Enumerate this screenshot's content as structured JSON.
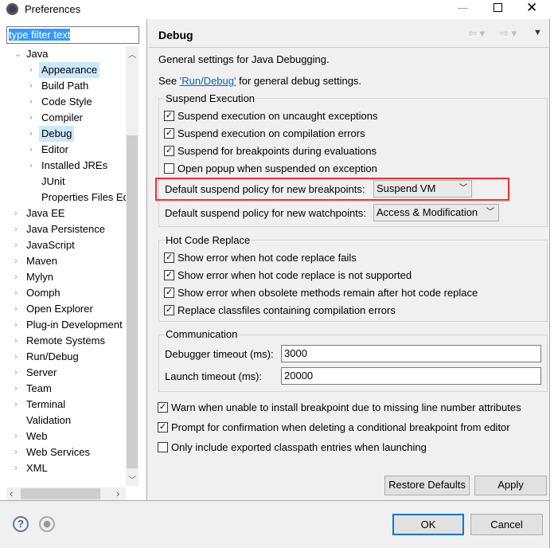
{
  "window": {
    "title": "Preferences"
  },
  "filter": {
    "placeholder": "type filter text"
  },
  "tree": [
    {
      "label": "Java",
      "level": 0,
      "expanded": true
    },
    {
      "label": "Appearance",
      "level": 1
    },
    {
      "label": "Build Path",
      "level": 1
    },
    {
      "label": "Code Style",
      "level": 1
    },
    {
      "label": "Compiler",
      "level": 1
    },
    {
      "label": "Debug",
      "level": 1,
      "selected": true
    },
    {
      "label": "Editor",
      "level": 1
    },
    {
      "label": "Installed JREs",
      "level": 1
    },
    {
      "label": "JUnit",
      "level": 1,
      "leaf": true
    },
    {
      "label": "Properties Files Ed",
      "level": 1,
      "leaf": true
    },
    {
      "label": "Java EE",
      "level": 0
    },
    {
      "label": "Java Persistence",
      "level": 0
    },
    {
      "label": "JavaScript",
      "level": 0
    },
    {
      "label": "Maven",
      "level": 0
    },
    {
      "label": "Mylyn",
      "level": 0
    },
    {
      "label": "Oomph",
      "level": 0
    },
    {
      "label": "Open Explorer",
      "level": 0
    },
    {
      "label": "Plug-in Development",
      "level": 0
    },
    {
      "label": "Remote Systems",
      "level": 0
    },
    {
      "label": "Run/Debug",
      "level": 0
    },
    {
      "label": "Server",
      "level": 0
    },
    {
      "label": "Team",
      "level": 0
    },
    {
      "label": "Terminal",
      "level": 0
    },
    {
      "label": "Validation",
      "level": 0,
      "leaf": true
    },
    {
      "label": "Web",
      "level": 0
    },
    {
      "label": "Web Services",
      "level": 0
    },
    {
      "label": "XML",
      "level": 0
    }
  ],
  "page": {
    "title": "Debug",
    "desc": "General settings for Java Debugging.",
    "see_pre": "See ",
    "see_link": "'Run/Debug'",
    "see_post": " for general debug settings.",
    "suspend": {
      "title": "Suspend Execution",
      "items": [
        {
          "label": "Suspend execution on uncaught exceptions",
          "checked": true
        },
        {
          "label": "Suspend execution on compilation errors",
          "checked": true
        },
        {
          "label": "Suspend for breakpoints during evaluations",
          "checked": true
        },
        {
          "label": "Open popup when suspended on exception",
          "checked": false
        }
      ],
      "bp_policy_label": "Default suspend policy for new breakpoints:",
      "bp_policy_value": "Suspend VM",
      "wp_policy_label": "Default suspend policy for new watchpoints:",
      "wp_policy_value": "Access & Modification"
    },
    "hcr": {
      "title": "Hot Code Replace",
      "items": [
        {
          "label": "Show error when hot code replace fails",
          "checked": true
        },
        {
          "label": "Show error when hot code replace is not supported",
          "checked": true
        },
        {
          "label": "Show error when obsolete methods remain after hot code replace",
          "checked": true
        },
        {
          "label": "Replace classfiles containing compilation errors",
          "checked": true
        }
      ]
    },
    "comm": {
      "title": "Communication",
      "timeout_label": "Debugger timeout (ms):",
      "timeout_value": "3000",
      "launch_label": "Launch timeout (ms):",
      "launch_value": "20000"
    },
    "misc": [
      {
        "label": "Warn when unable to install breakpoint due to missing line number attributes",
        "checked": true
      },
      {
        "label": "Prompt for confirmation when deleting a conditional breakpoint from editor",
        "checked": true
      },
      {
        "label": "Only include exported classpath entries when launching",
        "checked": false
      }
    ],
    "restore": "Restore Defaults",
    "apply": "Apply"
  },
  "footer": {
    "ok": "OK",
    "cancel": "Cancel"
  },
  "colors": {
    "highlight": "#ff2b2b",
    "selection": "#cce8ff",
    "link": "#0066cc"
  }
}
